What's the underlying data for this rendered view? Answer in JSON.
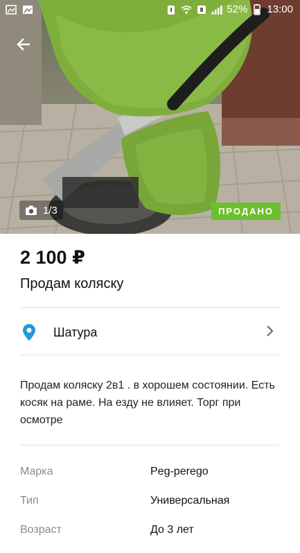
{
  "status_bar": {
    "battery_percent": "52%",
    "time": "13:00"
  },
  "photo": {
    "counter": "1/3",
    "badge": "ПРОДАНО"
  },
  "listing": {
    "price": "2 100 ₽",
    "title": "Продам коляску",
    "location": "Шатура",
    "description": "Продам коляску 2в1 . в хорошем состоянии. Есть косяк на раме. На езду не влияет. Торг при осмотре"
  },
  "params": [
    {
      "label": "Марка",
      "value": "Peg-perego"
    },
    {
      "label": "Тип",
      "value": "Универсальная"
    },
    {
      "label": "Возраст",
      "value": "До 3 лет"
    }
  ],
  "colors": {
    "accent_blue": "#1e9bd7",
    "sold_green": "#6cbf2f",
    "stroller_green": "#7fae3d"
  },
  "icons": {
    "back": "arrow-left-icon",
    "camera": "camera-icon",
    "location": "map-pin-icon",
    "chevron": "chevron-right-icon"
  }
}
